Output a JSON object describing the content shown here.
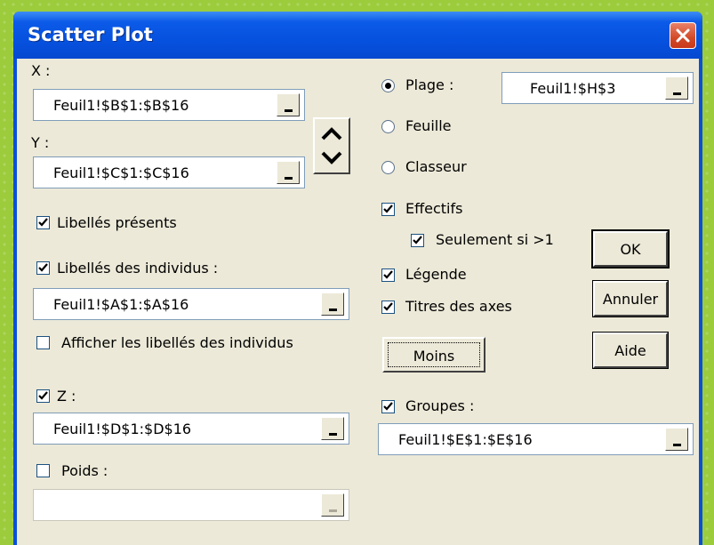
{
  "window": {
    "title": "Scatter Plot",
    "close_icon": "close-icon",
    "titlebar_color": "#0652df",
    "close_color": "#d24a28"
  },
  "left": {
    "x_label": "X :",
    "x_value": "Feuil1!$B$1:$B$16",
    "y_label": "Y :",
    "y_value": "Feuil1!$C$1:$C$16",
    "swap_icon": "swap-up-down-icon",
    "libelles_presents": {
      "label": "Libellés présents",
      "checked": true
    },
    "libelles_individus": {
      "label": "Libellés des individus :",
      "checked": true
    },
    "libelles_value": "Feuil1!$A$1:$A$16",
    "afficher_libelles": {
      "label": "Afficher les libellés des individus",
      "checked": false
    },
    "z": {
      "label": "Z :",
      "checked": true
    },
    "z_value": "Feuil1!$D$1:$D$16",
    "poids": {
      "label": "Poids :",
      "checked": false
    },
    "poids_value": ""
  },
  "right": {
    "plage": {
      "label": "Plage :",
      "selected": true
    },
    "plage_value": "Feuil1!$H$3",
    "feuille": {
      "label": "Feuille",
      "selected": false
    },
    "classeur": {
      "label": "Classeur",
      "selected": false
    },
    "effectifs": {
      "label": "Effectifs",
      "checked": true
    },
    "seulement": {
      "label": "Seulement si >1",
      "checked": true
    },
    "legende": {
      "label": "Légende",
      "checked": true
    },
    "titres_axes": {
      "label": "Titres des axes",
      "checked": true
    },
    "moins_label": "Moins",
    "groupes": {
      "label": "Groupes :",
      "checked": true
    },
    "groupes_value": "Feuil1!$E$1:$E$16"
  },
  "buttons": {
    "ok": "OK",
    "annuler": "Annuler",
    "aide": "Aide"
  }
}
